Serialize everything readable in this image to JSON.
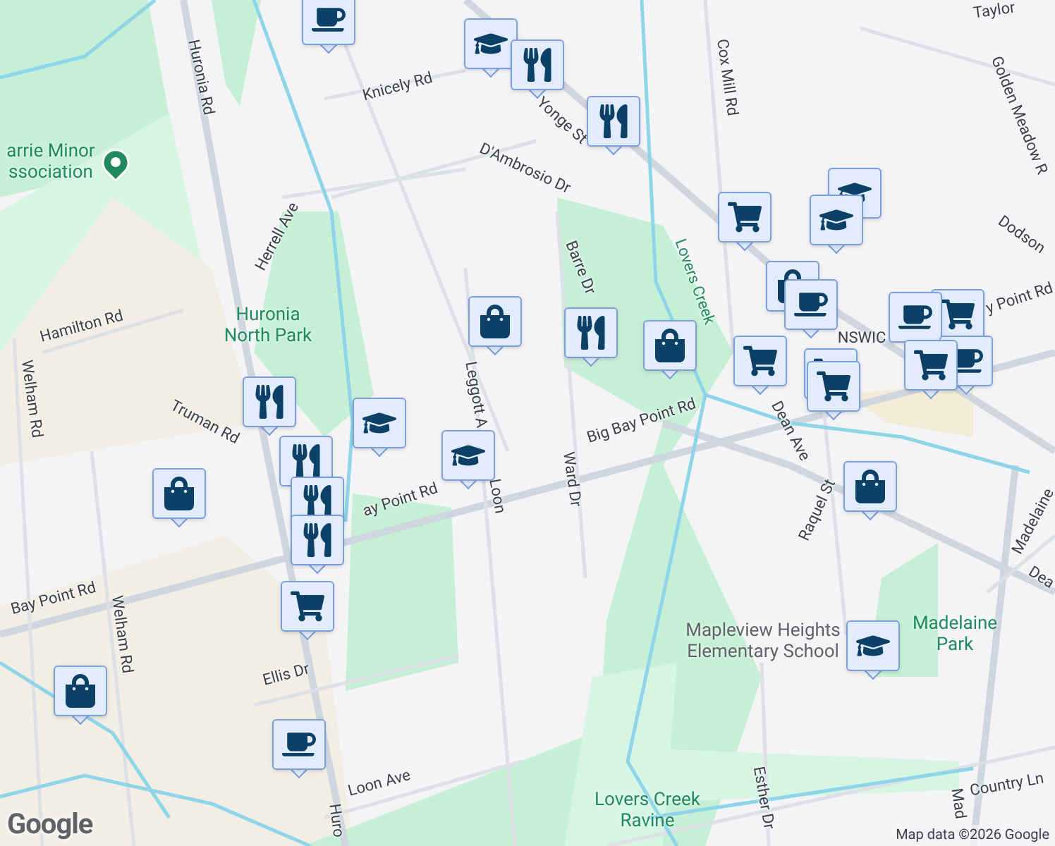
{
  "map": {
    "labels": [
      {
        "text": "Taylor",
        "kind": "street"
      },
      {
        "text": "Huronia Rd",
        "kind": "street"
      },
      {
        "text": "Knicely Rd",
        "kind": "street"
      },
      {
        "text": "Yonge St",
        "kind": "street"
      },
      {
        "text": "D'Ambrosio Dr",
        "kind": "street"
      },
      {
        "text": "Cox Mill Rd",
        "kind": "street"
      },
      {
        "text": "Golden Meadow R",
        "kind": "street"
      },
      {
        "text": "Dodson",
        "kind": "street"
      },
      {
        "text": "Herrell Ave",
        "kind": "street"
      },
      {
        "text": "Hamilton Rd",
        "kind": "street"
      },
      {
        "text": "Welham Rd",
        "kind": "street"
      },
      {
        "text": "Truman Rd",
        "kind": "street"
      },
      {
        "text": "Barre Dr",
        "kind": "street"
      },
      {
        "text": "Leggott A",
        "kind": "street"
      },
      {
        "text": "Loon",
        "kind": "street"
      },
      {
        "text": "Big Bay Point Rd",
        "kind": "street"
      },
      {
        "text": "y Point Rd",
        "kind": "street"
      },
      {
        "text": "ay Point Rd",
        "kind": "street"
      },
      {
        "text": "NSWIC",
        "kind": "street"
      },
      {
        "text": "Dean Ave",
        "kind": "street"
      },
      {
        "text": "Bay Point Rd",
        "kind": "street"
      },
      {
        "text": "Welham Rd",
        "kind": "street"
      },
      {
        "text": "Ward Dr",
        "kind": "street"
      },
      {
        "text": "Raquel St",
        "kind": "street"
      },
      {
        "text": "Madelaine",
        "kind": "street"
      },
      {
        "text": "Dea",
        "kind": "street"
      },
      {
        "text": "Ellis Dr",
        "kind": "street"
      },
      {
        "text": "Loon Ave",
        "kind": "street"
      },
      {
        "text": "Huro",
        "kind": "street"
      },
      {
        "text": "Esther Dr",
        "kind": "street"
      },
      {
        "text": "Country Ln",
        "kind": "street"
      },
      {
        "text": "Mad",
        "kind": "street"
      },
      {
        "text": "Lovers Creek",
        "kind": "water"
      },
      {
        "text": "arrie Minor\nssociation",
        "kind": "park"
      },
      {
        "text": "Huronia\nNorth Park",
        "kind": "park"
      },
      {
        "text": "Mapleview Heights\nElementary School",
        "kind": "poi"
      },
      {
        "text": "Madelaine\nPark",
        "kind": "park"
      },
      {
        "text": "Lovers Creek\nRavine",
        "kind": "park"
      }
    ],
    "markers": [
      {
        "kind": "cafe"
      },
      {
        "kind": "school"
      },
      {
        "kind": "restaurant"
      },
      {
        "kind": "restaurant"
      },
      {
        "kind": "grocery"
      },
      {
        "kind": "school"
      },
      {
        "kind": "school"
      },
      {
        "kind": "shop"
      },
      {
        "kind": "cafe"
      },
      {
        "kind": "restaurant"
      },
      {
        "kind": "shop"
      },
      {
        "kind": "grocery"
      },
      {
        "kind": "grocery"
      },
      {
        "kind": "cafe"
      },
      {
        "kind": "cafe"
      },
      {
        "kind": "grocery"
      },
      {
        "kind": "grocery"
      },
      {
        "kind": "grocery"
      },
      {
        "kind": "shop"
      },
      {
        "kind": "restaurant"
      },
      {
        "kind": "school"
      },
      {
        "kind": "school"
      },
      {
        "kind": "restaurant"
      },
      {
        "kind": "shop"
      },
      {
        "kind": "restaurant"
      },
      {
        "kind": "restaurant"
      },
      {
        "kind": "grocery"
      },
      {
        "kind": "shop"
      },
      {
        "kind": "school"
      },
      {
        "kind": "shop"
      },
      {
        "kind": "cafe"
      }
    ]
  },
  "attribution": {
    "logo": "Google",
    "text": "Map data ©2026 Google"
  }
}
